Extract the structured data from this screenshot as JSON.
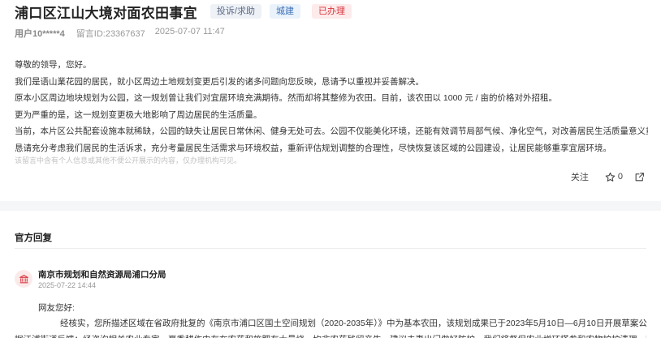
{
  "header": {
    "title": "浦口区江山大境对面农田事宜",
    "tags": [
      "投诉/求助",
      "城建",
      "已办理"
    ]
  },
  "meta": {
    "user": "用户10*****4",
    "message_id": "留言ID:23367637",
    "datetime": "2025-07-07 11:47"
  },
  "message": {
    "lines": [
      "尊敬的领导，您好。",
      "我们是语山業花园的居民，就小区周边土地规划变更后引发的诸多问题向您反映，恳请予以重视并妥善解决。",
      "原本小区周边地块规划为公园，这一规划曾让我们对宜居环境充满期待。然而却将其整修为农田。目前，该农田以 1000 元 / 亩的价格对外招租。",
      "更为严重的是，这一规划变更极大地影响了周边居民的生活质量。",
      " 当前，本片区公共配套设施本就稀缺，公园的缺失让居民日常休闲、健身无处可去。公园不仅能美化环境，还能有效调节局部气候、净化空气，对改善居民生活质量意义重大。",
      "恳请充分考虑我们居民的生活诉求，充分考量居民生活需求与环境权益，重新评估规划调整的合理性，尽快恢复该区域的公园建设，让居民能够重享宜居环境。"
    ],
    "notice": "该留言中含有个人信息或其他不便公开展示的内容，仅办理机构可见。"
  },
  "actions": {
    "follow_label": "关注",
    "like_count": "0"
  },
  "reply": {
    "section_title": "官方回复",
    "org_name": "南京市规划和自然资源局浦口分局",
    "date": "2025-07-22 14:44",
    "greeting": "网友您好:",
    "lines": [
      "经核实，您所描述区域在省政府批复的《南京市浦口区国土空间规划（2020-2035年）》中为基本农田，该规划成果已于2023年5月10日—6月10日开展草案公示。另",
      "据江浦街道反馈：经咨询相关农业专家，夏季耕作中存在农药和施肥有大量烧，均非农药残留产生，建议夫妻出门做好防护。我们将督促农业增环搭参和农物护护清理，防止"
    ]
  },
  "colors": {
    "status_red": "#d9363e",
    "area_blue": "#3b6fb6",
    "type_gray": "#5b6b86"
  }
}
